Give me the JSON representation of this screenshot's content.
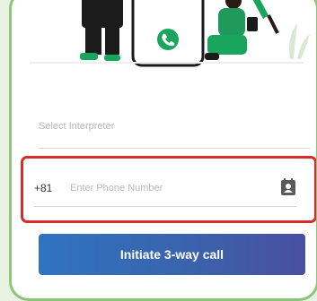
{
  "form": {
    "interpreter_placeholder": "Select Interpreter",
    "country_code": "+81",
    "phone_placeholder": "Enter Phone Number",
    "submit_label": "Initiate 3-way call"
  },
  "icons": {
    "contact": "contact-book-icon",
    "phone": "phone-icon"
  },
  "colors": {
    "card_border": "#8fc47b",
    "highlight_border": "#d92b2b",
    "button_start": "#2f74c1",
    "button_end": "#4a4fa0",
    "accent_green": "#1aa55d"
  }
}
